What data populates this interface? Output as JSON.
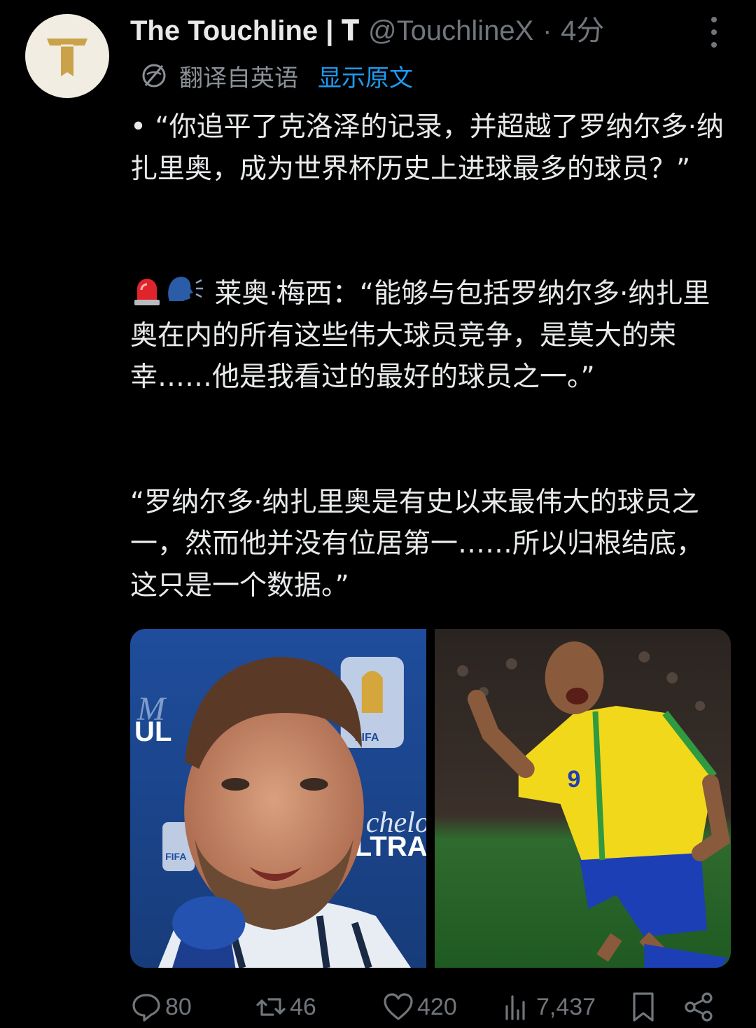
{
  "author": {
    "display_name": "The Touchline | 𝐓",
    "handle": "@TouchlineX",
    "separator": "·",
    "time": "4分",
    "avatar_letter": "T"
  },
  "translation": {
    "label": "翻译自英语",
    "show_original": "显示原文"
  },
  "tweet": {
    "paragraph1": "• “你追平了克洛泽的记录，并超越了罗纳尔多·纳扎里奥，成为世界杯历史上进球最多的球员？”",
    "paragraph2_emojis": "🚨🗣",
    "paragraph2": " 莱奥·梅西：“能够与包括罗纳尔多·纳扎里奥在内的所有这些伟大球员竞争，是莫大的荣幸……他是我看过的最好的球员之一。”",
    "paragraph3": "“罗纳尔多·纳扎里奥是有史以来最伟大的球员之一，然而他并没有位居第一……所以归根结底，这只是一个数据。”"
  },
  "media": {
    "left_image_text": [
      "FIFA",
      "UL",
      "chelot",
      "LTRA",
      "FIFA"
    ],
    "right_image_text": [
      "9"
    ]
  },
  "actions": {
    "replies": "80",
    "retweets": "46",
    "likes": "420",
    "views": "7,437"
  },
  "colors": {
    "background": "#000000",
    "text": "#e7e9ea",
    "secondary": "#71767b",
    "link": "#1d9bf0",
    "avatar_bg": "#f2ede3",
    "avatar_gold": "#c9a24a"
  },
  "icons": [
    "avatar-logo",
    "more-icon",
    "translate-icon",
    "siren-emoji",
    "speaking-head-emoji",
    "reply-icon",
    "retweet-icon",
    "like-icon",
    "views-icon",
    "bookmark-icon",
    "share-icon"
  ]
}
